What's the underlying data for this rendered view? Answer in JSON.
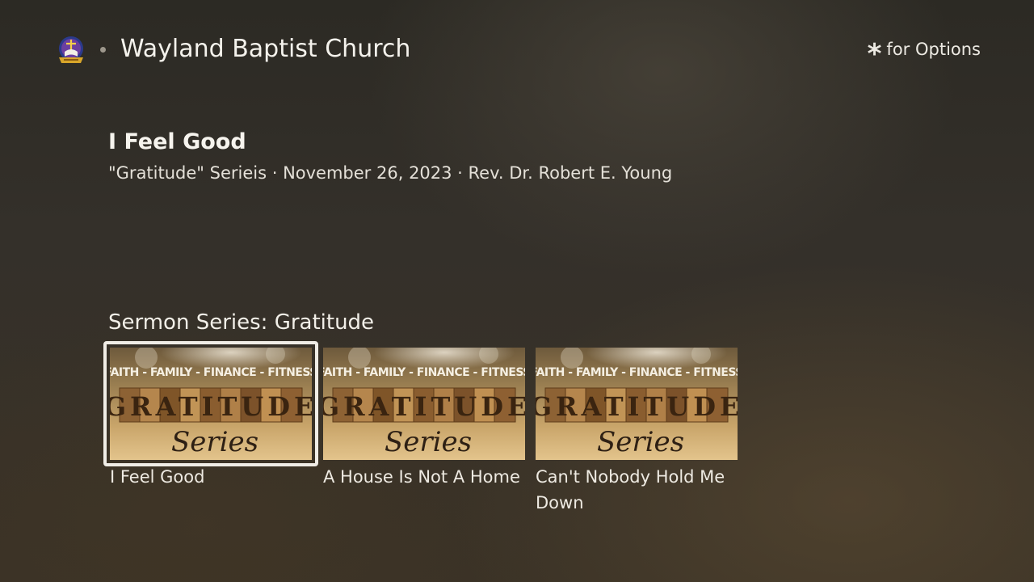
{
  "header": {
    "app_title": "Wayland Baptist Church",
    "options_key": "*",
    "options_label": "for Options"
  },
  "selected": {
    "title": "I Feel Good",
    "meta": "\"Gratitude\" Serieis · November 26, 2023 · Rev. Dr. Robert E. Young"
  },
  "row": {
    "title": "Sermon Series: Gratitude",
    "items": [
      {
        "label": "I Feel Good",
        "thumb": {
          "top": "FAITH - FAMILY - FINANCE - FITNESS",
          "word": "GRATITUDE",
          "script": "Series"
        }
      },
      {
        "label": "A House Is Not A Home",
        "thumb": {
          "top": "FAITH - FAMILY - FINANCE - FITNESS",
          "word": "GRATITUDE",
          "script": "Series"
        }
      },
      {
        "label": "Can't Nobody Hold Me Down",
        "thumb": {
          "top": "FAITH - FAMILY - FINANCE - FITNESS",
          "word": "GRATITUDE",
          "script": "Series"
        }
      }
    ]
  },
  "colors": {
    "focus_border": "#f0ede6",
    "text_primary": "#f4f2ec",
    "background": "#2f2b25"
  }
}
